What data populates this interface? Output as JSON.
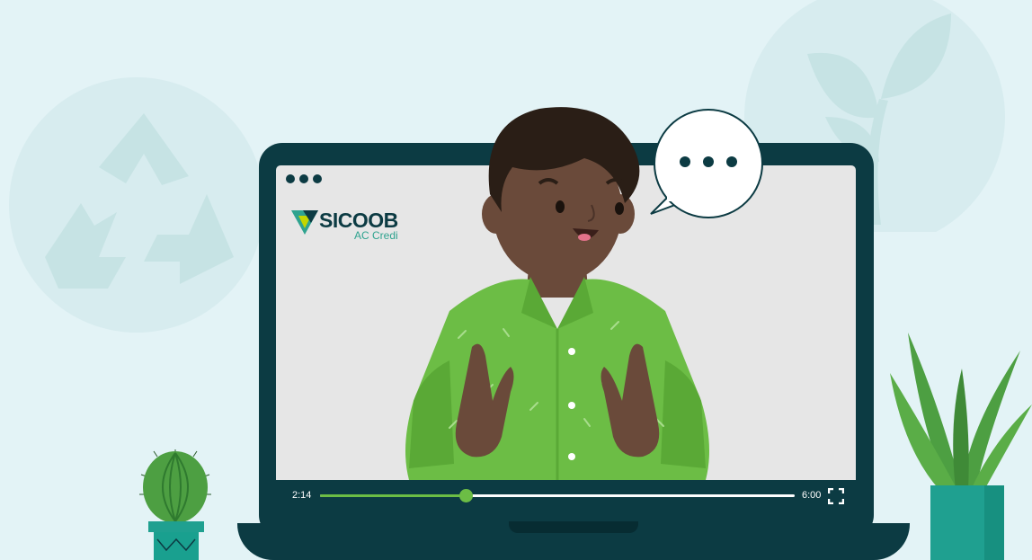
{
  "brand": {
    "name": "SICOOB",
    "subtitle": "AC Credi",
    "colors": {
      "dark": "#0c3b43",
      "teal": "#2fa38f",
      "green": "#6cbd45",
      "lime": "#c4d600",
      "background": "#e3f3f6"
    }
  },
  "window": {
    "dots": [
      "dot",
      "dot",
      "dot"
    ]
  },
  "player": {
    "current_time": "2:14",
    "total_time": "6:00",
    "progress": 0.307,
    "fullscreen_icon": "fullscreen-icon"
  },
  "speech_bubble": {
    "icon": "ellipsis-icon"
  },
  "decorations": {
    "icons": [
      "recycle-icon",
      "sprout-icon",
      "cactus-icon",
      "snake-plant-icon"
    ]
  }
}
